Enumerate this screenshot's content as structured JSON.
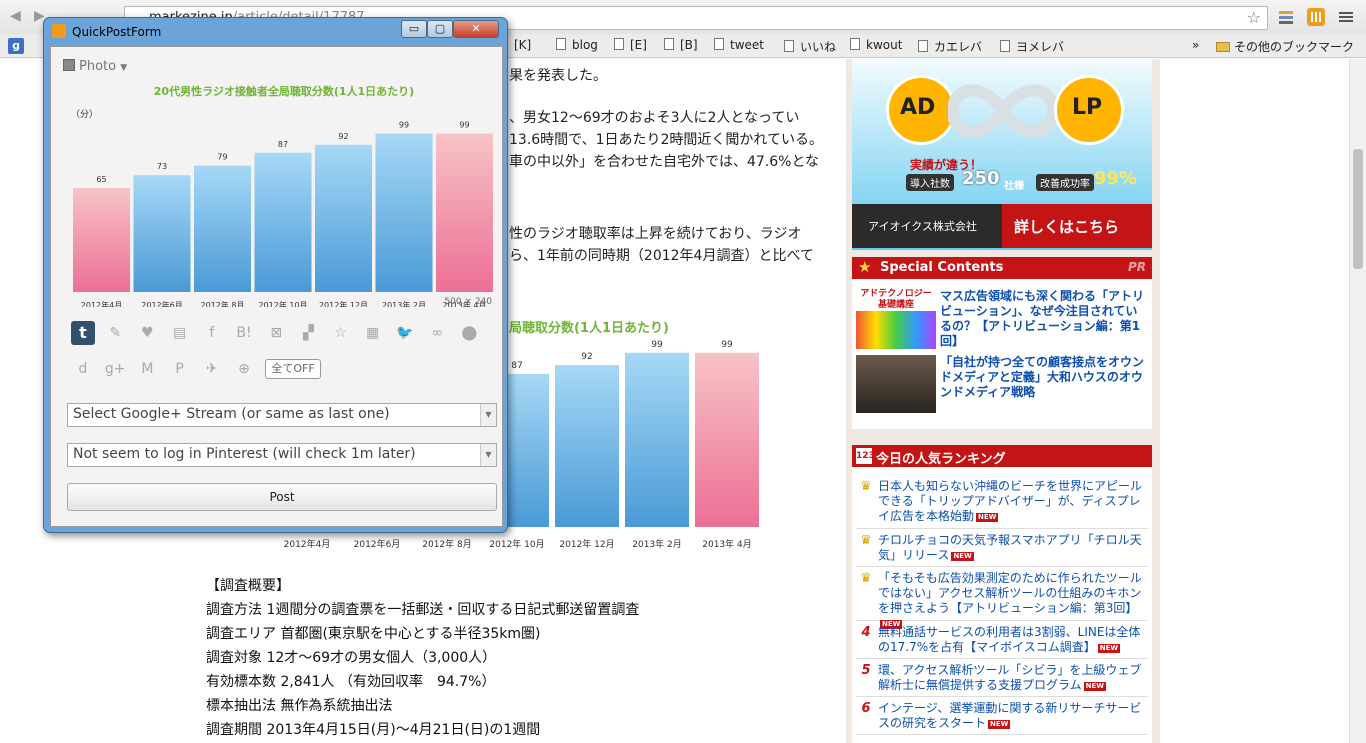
{
  "browser": {
    "url_domain": "markezine.jp",
    "url_path": "/article/detail/17787",
    "bookmarks": [
      "[K]",
      "blog",
      "[E]",
      "[B]",
      "tweet",
      "いいね",
      "kwout",
      "カエレバ",
      "ヨメレバ"
    ],
    "bookmark_overflow": "»",
    "other_bookmarks": "その他のブックマーク",
    "icons": [
      "back-icon",
      "forward-icon",
      "star-icon",
      "bookmark-toolbar-icon",
      "wrench-icon",
      "google-icon"
    ]
  },
  "article": {
    "line0": "果を発表した。",
    "line1": "、男女12～69才のおよそ3人に2人となってい",
    "line2": "13.6時間で、1日あたり2時間近く聞かれている。",
    "line3": "車の中以外」を合わせた自宅外では、47.6%とな",
    "line4": "性のラジオ聴取率は上昇を続けており、ラジオ",
    "line5": "ら、1年前の同時期（2012年4月調査）と比べて",
    "chart_title_partial": "局聴取分数(1人1日あたり)",
    "survey": [
      "【調査概要】",
      "調査方法 1週間分の調査票を一括郵送・回収する日記式郵送留置調査",
      "調査エリア 首都圏(東京駅を中心とする半径35km圏)",
      "調査対象 12才～69才の男女個人（3,000人）",
      "有効標本数 2,841人 （有効回収率　94.7%）",
      "標本抽出法 無作為系統抽出法",
      "調査期間 2013年4月15日(月)～4月21日(日)の1週間"
    ]
  },
  "ad": {
    "left_tag": "AD",
    "right_tag": "LP",
    "headline": "実績が違う！",
    "stat1_label": "導入社数",
    "stat1_value": "250",
    "stat1_unit": "社様",
    "stat2_label": "改善成功率",
    "stat2_value": "99%",
    "company": "アイオイクス株式会社",
    "cta": "詳しくはこちら"
  },
  "special": {
    "title": "Special Contents",
    "pr": "PR",
    "thumb1_caption": "アドテクノロジー基礎講座",
    "items": [
      "マス広告領域にも深く関わる「アトリビューション」、なぜ今注目されているの？【アトリビューション編：第1回】",
      "「自社が持つ全ての顧客接点をオウンドメディアと定義」大和ハウスのオウンドメディア戦略"
    ]
  },
  "ranking": {
    "title": "今日の人気ランキング",
    "new_label": "NEW",
    "items": [
      {
        "rank": "1",
        "text": "日本人も知らない沖縄のビーチを世界にアピールできる「トリップアドバイザー」が、ディスプレイ広告を本格始動"
      },
      {
        "rank": "2",
        "text": "チロルチョコの天気予報スマホアプリ「チロル天気」リリース"
      },
      {
        "rank": "3",
        "text": "「そもそも広告効果測定のために作られたツールではない」アクセス解析ツールの仕組みのキホンを押さえよう【アトリビューション編：第3回】"
      },
      {
        "rank": "4",
        "text": "無料通話サービスの利用者は3割弱、LINEは全体の17.7%を占有【マイボイスコム調査】"
      },
      {
        "rank": "5",
        "text": "環、アクセス解析ツール「シビラ」を上級ウェブ解析士に無償提供する支援プログラム"
      },
      {
        "rank": "6",
        "text": "インテージ、選挙運動に関する新リサーチサービスの研究をスタート"
      }
    ]
  },
  "popup": {
    "title": "QuickPostForm",
    "window_buttons": {
      "minimize": "▭",
      "maximize": "▢",
      "close": "✕"
    },
    "photo_label": "Photo",
    "image_size": "500 × 240",
    "services_row1": [
      "tumblr-icon",
      "pen-icon",
      "heart-icon",
      "stack-icon",
      "facebook-icon",
      "bi-icon",
      "star-box-icon",
      "cube-icon",
      "star-icon",
      "news-icon",
      "twitter-icon",
      "link-icon",
      "location-icon"
    ],
    "services_row1_glyphs": [
      "t",
      "✎",
      "♥",
      "▤",
      "f",
      "B!",
      "⊠",
      "▞",
      "☆",
      "▦",
      "🐦",
      "∞",
      "⬤"
    ],
    "services_row2": [
      "dropbox-icon",
      "googleplus-icon",
      "gmail-icon",
      "pinterest-icon",
      "evernote-icon",
      "plus-icon"
    ],
    "services_row2_glyphs": [
      "d",
      "g+",
      "M",
      "P",
      "✈",
      "⊕"
    ],
    "all_off": "全てOFF",
    "gplus_select": "Select Google+ Stream (or same as last one)",
    "pinterest_select": "Not seem to log in Pinterest (will check 1m later)",
    "post_button": "Post"
  },
  "colors": {
    "bar_blue_top": "#a6d8f6",
    "bar_blue_bottom": "#4a9ad6",
    "bar_pink_top": "#f7c3c6",
    "bar_pink_bottom": "#ec6f95",
    "chart_title": "#6fb535",
    "accent_red": "#c41416",
    "link_blue": "#0d4faf"
  },
  "chart_data": [
    {
      "type": "bar",
      "title": "20代男性ラジオ接触者全局聴取分数(1人1日あたり)",
      "ylabel": "（分）",
      "categories": [
        "2012年4月",
        "2012年6月",
        "2012年 8月",
        "2012年 10月",
        "2012年 12月",
        "2013年 2月",
        "2013年 4月"
      ],
      "values": [
        65,
        73,
        79,
        87,
        92,
        99,
        99
      ],
      "highlight": [
        0,
        6
      ],
      "ylim": [
        0,
        100
      ],
      "grid": false,
      "legend": "none"
    },
    {
      "type": "bar",
      "title": "局聴取分数(1人1日あたり)",
      "categories": [
        "2012年4月",
        "2012年6月",
        "2012年 8月",
        "2012年 10月",
        "2012年 12月",
        "2013年 2月",
        "2013年 4月"
      ],
      "values": [
        65,
        73,
        79,
        87,
        92,
        99,
        99
      ],
      "highlight": [
        0,
        6
      ],
      "ylim": [
        0,
        100
      ],
      "grid": false,
      "legend": "none"
    }
  ]
}
